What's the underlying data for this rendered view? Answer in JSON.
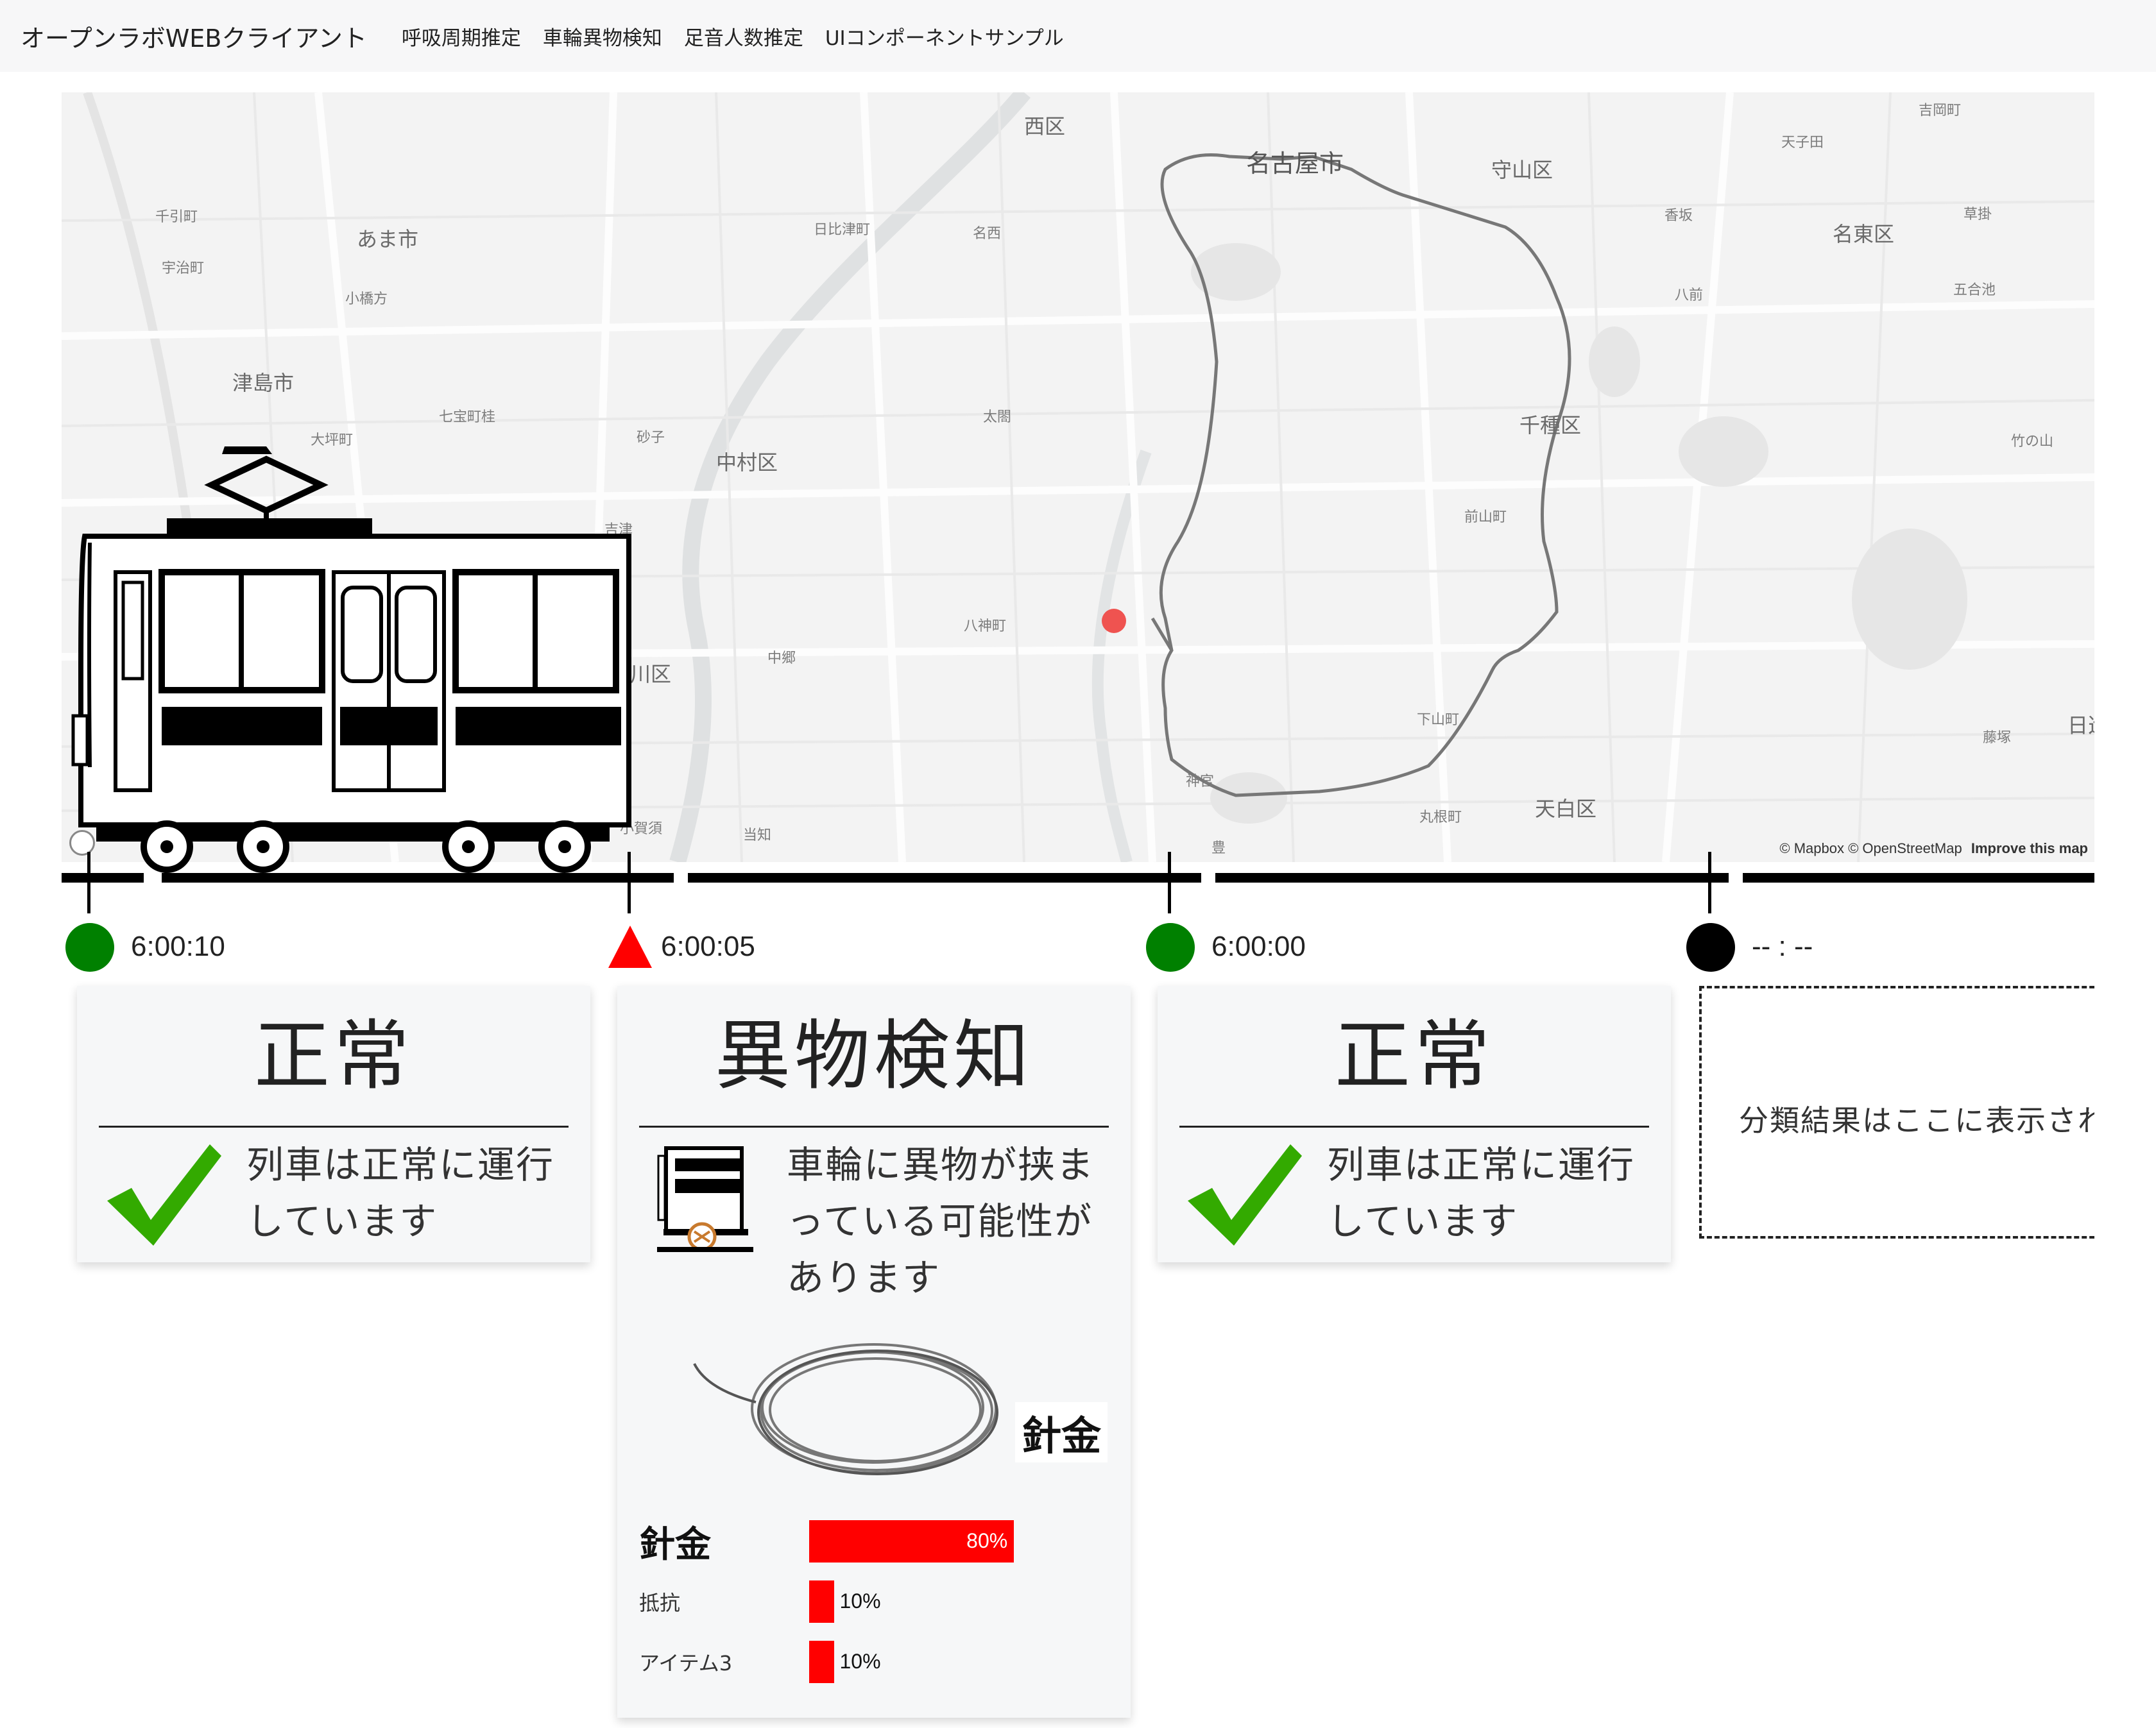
{
  "navbar": {
    "brand": "オープンラボWEBクライアント",
    "links": [
      "呼吸周期推定",
      "車輪異物検知",
      "足音人数推定",
      "UIコンポーネントサンプル"
    ]
  },
  "map": {
    "labels": {
      "nishi": "西区",
      "nagoya": "名古屋市",
      "moriyama": "守山区",
      "meito": "名東区",
      "chikusa": "千種区",
      "tenpaku": "天白区",
      "nakamura": "中村区",
      "ama": "あま市",
      "tsushima": "津島市",
      "nakagawa": "川区",
      "nisshin": "日進",
      "senbiki": "千引町",
      "ujimachi": "宇治町",
      "kobata": "小橋方",
      "otsubo": "大坪町",
      "shippo": "七宝町桂",
      "sunago": "砂子",
      "yoshizu": "吉津",
      "biwajima": "日比津町",
      "meisei": "名西",
      "taiko": "太閤",
      "yagoto": "八神町",
      "nakago": "中郷",
      "koka": "小賀須",
      "tochi": "当知",
      "jingu": "神宮",
      "yutaka": "豊",
      "shimoyama": "下山町",
      "marune": "丸根町",
      "maeyama": "前山町",
      "kozaka": "香坂",
      "yamae": "八前",
      "tenshiden": "天子田",
      "yoshioka": "吉岡町",
      "kusakake": "草掛",
      "gogoike": "五合池",
      "takenoyama": "竹の山",
      "fujitsuka": "藤塚"
    },
    "attribution": "© Mapbox © OpenStreetMap",
    "improve": "Improve this map",
    "route_color": "#777777",
    "position_color": "#ef5350"
  },
  "timeline": {
    "markers": [
      {
        "status": "normal",
        "color": "#008000",
        "time": "6:00:10"
      },
      {
        "status": "anomaly",
        "color": "#ff0000",
        "time": "6:00:05"
      },
      {
        "status": "normal",
        "color": "#008000",
        "time": "6:00:00"
      },
      {
        "status": "pending",
        "color": "#000000",
        "time": "-- : --"
      }
    ]
  },
  "cards": [
    {
      "title": "正常",
      "desc_line1": "列車は正常に運行",
      "desc_line2": "しています",
      "icon": "check-icon"
    },
    {
      "title": "異物検知",
      "desc_line1": "車輪に異物が挟ま",
      "desc_line2": "っている可能性が",
      "desc_line3": "あります",
      "icon": "train-wheel-icon",
      "object_caption": "針金",
      "classification": [
        {
          "label": "針金",
          "value": 80,
          "text": "80%"
        },
        {
          "label": "抵抗",
          "value": 10,
          "text": "10%"
        },
        {
          "label": "アイテム3",
          "value": 10,
          "text": "10%"
        }
      ]
    },
    {
      "title": "正常",
      "desc_line1": "列車は正常に運行",
      "desc_line2": "しています",
      "icon": "check-icon"
    }
  ],
  "placeholder": {
    "text": "分類結果はここに表示され"
  },
  "colors": {
    "accent_red": "#ff0000",
    "normal_green": "#008000",
    "check_green": "#33aa00"
  }
}
